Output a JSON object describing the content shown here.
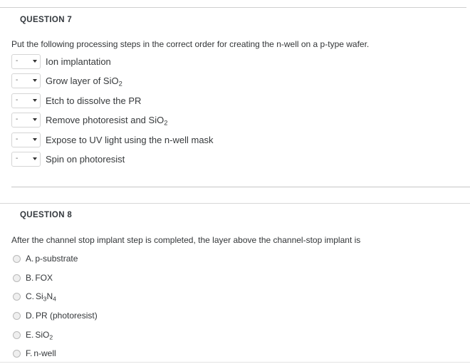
{
  "question7": {
    "heading": "QUESTION 7",
    "prompt": "Put the following processing steps in the correct order for creating the n-well on a p-type wafer.",
    "select_placeholder": "-",
    "caret_icon": "chevron-down-icon",
    "steps": [
      {
        "label": "Ion implantation",
        "value": "-"
      },
      {
        "label": "Grow layer of SiO2",
        "value": "-",
        "text_main": "Grow layer of SiO",
        "sub": "2"
      },
      {
        "label": "Etch to dissolve the PR",
        "value": "-"
      },
      {
        "label": "Remove photoresist and SiO2",
        "value": "-",
        "text_main": "Remove photoresist and SiO",
        "sub": "2"
      },
      {
        "label": "Expose to UV light using the n-well mask",
        "value": "-"
      },
      {
        "label": "Spin on photoresist",
        "value": "-"
      }
    ]
  },
  "question8": {
    "heading": "QUESTION 8",
    "prompt": "After the channel stop implant step is completed, the layer above the channel-stop implant is",
    "options": [
      {
        "letter": "A.",
        "label": "p-substrate",
        "selected": false
      },
      {
        "letter": "B.",
        "label": "FOX",
        "selected": false
      },
      {
        "letter": "C.",
        "label": "Si3N4",
        "selected": false
      },
      {
        "letter": "D.",
        "label": "PR (photoresist)",
        "selected": false
      },
      {
        "letter": "E.",
        "label": "SiO2",
        "selected": false
      },
      {
        "letter": "F.",
        "label": "n-well",
        "selected": false
      }
    ]
  },
  "colors": {
    "background": "#ffffff",
    "text": "#34373a",
    "heading": "#33383d",
    "rule": "#cfcfcf",
    "select_border": "#d5d5d5",
    "radio_fill": "#efefef"
  }
}
